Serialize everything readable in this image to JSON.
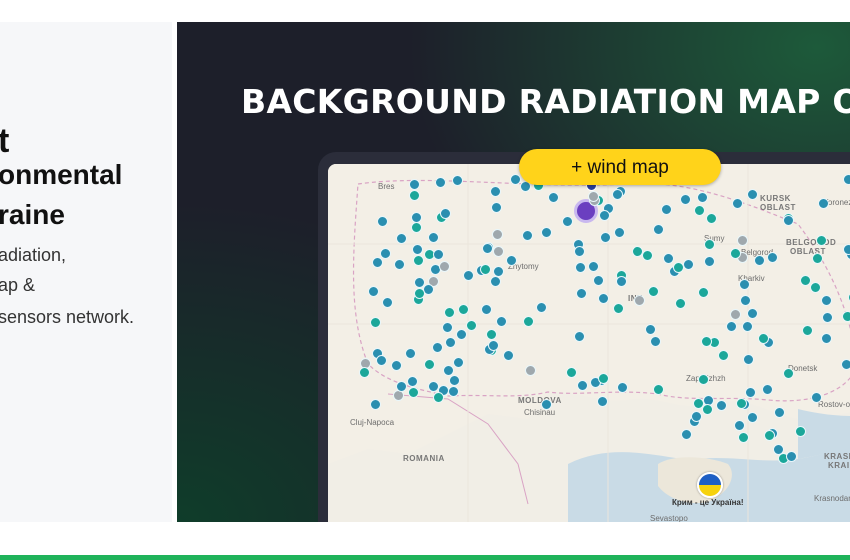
{
  "left": {
    "title_fragment": "t",
    "heading_lines": [
      "onmental",
      "raine"
    ],
    "desc_lines": [
      "adiation,",
      "ap &",
      "sensors network."
    ]
  },
  "banner": {
    "title": "BACKGROUND RADIATION MAP OF U",
    "wind_button": "+ wind map"
  },
  "map_labels": {
    "kursk": "KURSK",
    "kursk2": "OBLAST",
    "voronezh": "Voronez",
    "belgorod_oblast": "BELGOROD",
    "belgorod_oblast2": "OBLAST",
    "belgorod": "Belgorod",
    "sumy": "Sumy",
    "kharkiv": "Kharkiv",
    "zhytomyr": "Zhytomy",
    "ukraine": "INE",
    "zaporizhzhia": "Zaporizhzh",
    "donetsk": "Donetsk",
    "rostov": "Rostov-on",
    "moldova": "MOLDOVA",
    "chisinau": "Chisinau",
    "cluj": "Cluj-Napoca",
    "romania": "ROMANIA",
    "krasnodar_region": "KRASN",
    "krasnodar_region2": "KRAI",
    "krasnodar": "Krasnodar",
    "crimea_caption": "Крим - це Україна!",
    "sevastopol": "Sevastopo",
    "brest": "Bres"
  },
  "colors": {
    "accent_yellow": "#ffd31a",
    "sensor_blue": "#2a8fb0",
    "sensor_teal": "#1ba79a",
    "cluster_purple": "#6b3fc0",
    "footer_green": "#1fb35a"
  }
}
